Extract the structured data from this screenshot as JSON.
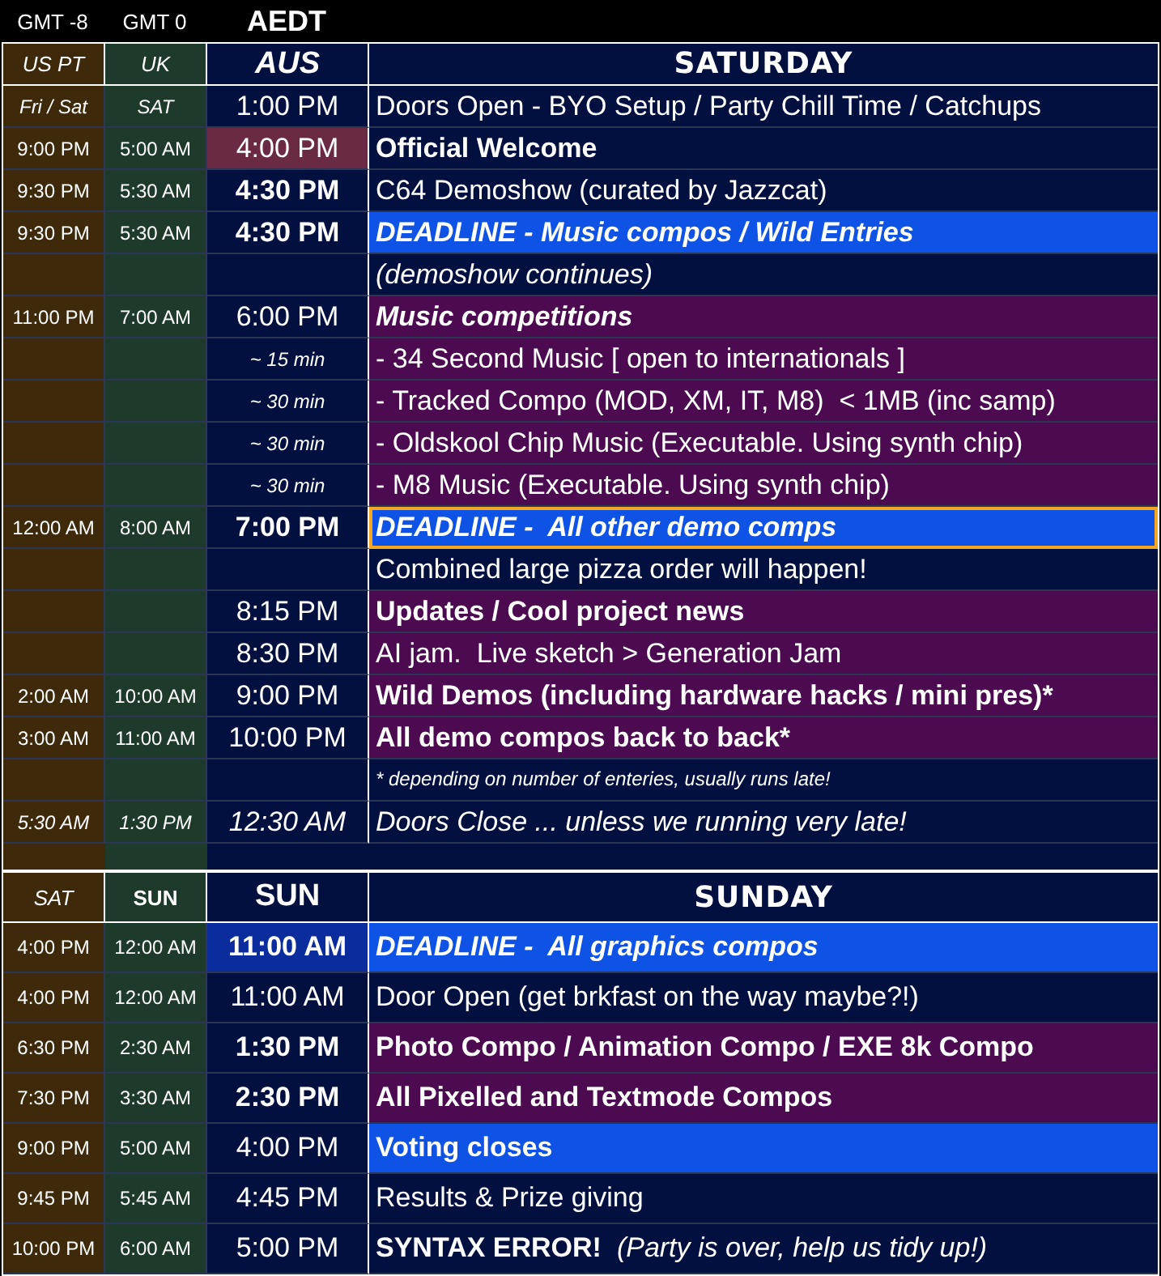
{
  "zones": [
    "GMT -8",
    "GMT 0",
    "AEDT"
  ],
  "days": [
    {
      "headers": [
        {
          "label": "US PT",
          "italic": true
        },
        {
          "label": "UK",
          "italic": true
        },
        {
          "label": "AUS",
          "italic": true
        }
      ],
      "title": "SATURDAY",
      "rows": [
        {
          "us": "Fri / Sat",
          "uk": "SAT",
          "zone_italic": true,
          "aus": "1:00 PM",
          "aus_bold": false,
          "aus_italic": false,
          "aus_small": false,
          "event": "Doors Open - BYO Setup / Party Chill Time / Catchups",
          "bold": false,
          "italic": false,
          "small": false,
          "kind": "plain",
          "selected": false
        },
        {
          "us": "9:00 PM",
          "uk": "5:00 AM",
          "zone_italic": false,
          "aus": "4:00 PM",
          "aus_bold": false,
          "aus_italic": false,
          "aus_small": false,
          "aus_highlight": true,
          "event": "Official Welcome",
          "bold": true,
          "italic": false,
          "small": false,
          "kind": "plain",
          "selected": false
        },
        {
          "us": "9:30 PM",
          "uk": "5:30 AM",
          "zone_italic": false,
          "aus": "4:30 PM",
          "aus_bold": true,
          "aus_italic": false,
          "aus_small": false,
          "event": "C64 Demoshow (curated by Jazzcat)",
          "bold": false,
          "italic": false,
          "small": false,
          "kind": "plain",
          "selected": false
        },
        {
          "us": "9:30 PM",
          "uk": "5:30 AM",
          "zone_italic": false,
          "aus": "4:30 PM",
          "aus_bold": true,
          "aus_italic": false,
          "aus_small": false,
          "event": "DEADLINE - Music compos / Wild Entries",
          "bold": true,
          "italic": true,
          "small": false,
          "kind": "deadline",
          "selected": false
        },
        {
          "event": "(demoshow continues)",
          "bold": false,
          "italic": true,
          "small": false,
          "kind": "plain",
          "selected": false
        },
        {
          "us": "11:00 PM",
          "uk": "7:00 AM",
          "zone_italic": false,
          "aus": "6:00 PM",
          "aus_bold": false,
          "aus_italic": false,
          "aus_small": false,
          "event": "Music competitions",
          "bold": true,
          "italic": true,
          "small": false,
          "kind": "compo",
          "selected": false
        },
        {
          "aus": "~ 15 min",
          "aus_bold": false,
          "aus_italic": true,
          "aus_small": true,
          "event": "- 34 Second Music [ open to internationals ]",
          "bold": false,
          "italic": false,
          "small": false,
          "kind": "compo",
          "selected": false
        },
        {
          "aus": "~ 30 min",
          "aus_bold": false,
          "aus_italic": true,
          "aus_small": true,
          "event": "- Tracked Compo (MOD, XM, IT, M8)  < 1MB (inc samp)",
          "bold": false,
          "italic": false,
          "small": false,
          "kind": "compo",
          "selected": false
        },
        {
          "aus": "~ 30 min",
          "aus_bold": false,
          "aus_italic": true,
          "aus_small": true,
          "event": "- Oldskool Chip Music (Executable. Using synth chip)",
          "bold": false,
          "italic": false,
          "small": false,
          "kind": "compo",
          "selected": false
        },
        {
          "aus": "~ 30 min",
          "aus_bold": false,
          "aus_italic": true,
          "aus_small": true,
          "event": "- M8 Music (Executable. Using synth chip)",
          "bold": false,
          "italic": false,
          "small": false,
          "kind": "compo",
          "selected": false
        },
        {
          "us": "12:00 AM",
          "uk": "8:00 AM",
          "zone_italic": false,
          "aus": "7:00 PM",
          "aus_bold": true,
          "aus_italic": false,
          "aus_small": false,
          "event": "DEADLINE -  All other demo comps",
          "bold": true,
          "italic": true,
          "small": false,
          "kind": "deadline",
          "selected": true
        },
        {
          "event": "Combined large pizza order will happen!",
          "bold": false,
          "italic": false,
          "small": false,
          "kind": "plain",
          "selected": false
        },
        {
          "aus": "8:15 PM",
          "aus_bold": false,
          "aus_italic": false,
          "aus_small": false,
          "event": "Updates / Cool project news",
          "bold": true,
          "italic": false,
          "small": false,
          "kind": "compo",
          "selected": false
        },
        {
          "aus": "8:30 PM",
          "aus_bold": false,
          "aus_italic": false,
          "aus_small": false,
          "event": "AI jam.  Live sketch > Generation Jam",
          "bold": false,
          "italic": false,
          "small": false,
          "kind": "compo",
          "selected": false
        },
        {
          "us": "2:00 AM",
          "uk": "10:00 AM",
          "zone_italic": false,
          "aus": "9:00 PM",
          "aus_bold": false,
          "aus_italic": false,
          "aus_small": false,
          "event": "Wild Demos (including hardware hacks / mini pres)*",
          "bold": true,
          "italic": false,
          "small": false,
          "kind": "compo",
          "selected": false
        },
        {
          "us": "3:00 AM",
          "uk": "11:00 AM",
          "zone_italic": false,
          "aus": "10:00 PM",
          "aus_bold": false,
          "aus_italic": false,
          "aus_small": false,
          "event": "All demo compos back to back*",
          "bold": true,
          "italic": false,
          "small": false,
          "kind": "compo",
          "selected": false
        },
        {
          "event": "* depending on number of enteries, usually runs late!",
          "bold": false,
          "italic": true,
          "small": true,
          "kind": "plain",
          "selected": false
        },
        {
          "us": "5:30 AM",
          "uk": "1:30 PM",
          "zone_italic": true,
          "aus": "12:30 AM",
          "aus_bold": false,
          "aus_italic": true,
          "aus_small": false,
          "event": "Doors Close ... unless we running very late!",
          "bold": false,
          "italic": true,
          "small": false,
          "kind": "plain",
          "selected": false
        }
      ]
    },
    {
      "headers": [
        {
          "label": "SAT",
          "italic": true
        },
        {
          "label": "SUN",
          "italic": false
        },
        {
          "label": "SUN",
          "italic": false
        }
      ],
      "title": "SUNDAY",
      "rows": [
        {
          "us": "4:00 PM",
          "uk": "12:00 AM",
          "zone_italic": false,
          "aus": "11:00 AM",
          "aus_bold": true,
          "aus_italic": false,
          "aus_small": false,
          "aus_highlight": true,
          "event": "DEADLINE -  All graphics compos",
          "bold": true,
          "italic": true,
          "small": false,
          "kind": "deadline",
          "selected": false
        },
        {
          "us": "4:00 PM",
          "uk": "12:00 AM",
          "zone_italic": false,
          "aus": "11:00 AM",
          "aus_bold": false,
          "aus_italic": false,
          "aus_small": false,
          "event": "Door Open (get brkfast on the way maybe?!)",
          "bold": false,
          "italic": false,
          "small": false,
          "kind": "plain",
          "selected": false
        },
        {
          "us": "6:30 PM",
          "uk": "2:30 AM",
          "zone_italic": false,
          "aus": "1:30 PM",
          "aus_bold": true,
          "aus_italic": false,
          "aus_small": false,
          "event": "Photo Compo / Animation Compo / EXE 8k Compo",
          "bold": true,
          "italic": false,
          "small": false,
          "kind": "compo",
          "selected": false
        },
        {
          "us": "7:30 PM",
          "uk": "3:30 AM",
          "zone_italic": false,
          "aus": "2:30 PM",
          "aus_bold": true,
          "aus_italic": false,
          "aus_small": false,
          "event": "All Pixelled and Textmode Compos",
          "bold": true,
          "italic": false,
          "small": false,
          "kind": "compo",
          "selected": false
        },
        {
          "us": "9:00 PM",
          "uk": "5:00 AM",
          "zone_italic": false,
          "aus": "4:00 PM",
          "aus_bold": false,
          "aus_italic": false,
          "aus_small": false,
          "event": "Voting closes",
          "bold": true,
          "italic": false,
          "small": false,
          "kind": "deadline",
          "selected": false
        },
        {
          "us": "9:45 PM",
          "uk": "5:45 AM",
          "zone_italic": false,
          "aus": "4:45 PM",
          "aus_bold": false,
          "aus_italic": false,
          "aus_small": false,
          "event": "Results & Prize giving",
          "bold": false,
          "italic": false,
          "small": false,
          "kind": "plain",
          "selected": false
        },
        {
          "us": "10:00 PM",
          "uk": "6:00 AM",
          "zone_italic": false,
          "aus": "5:00 PM",
          "aus_bold": false,
          "aus_italic": false,
          "aus_small": false,
          "event": "**SYNTAX ERROR!**  *(Party is over, help us tidy up!)*",
          "bold": false,
          "italic": false,
          "small": false,
          "kind": "plain",
          "selected": false
        }
      ]
    }
  ]
}
